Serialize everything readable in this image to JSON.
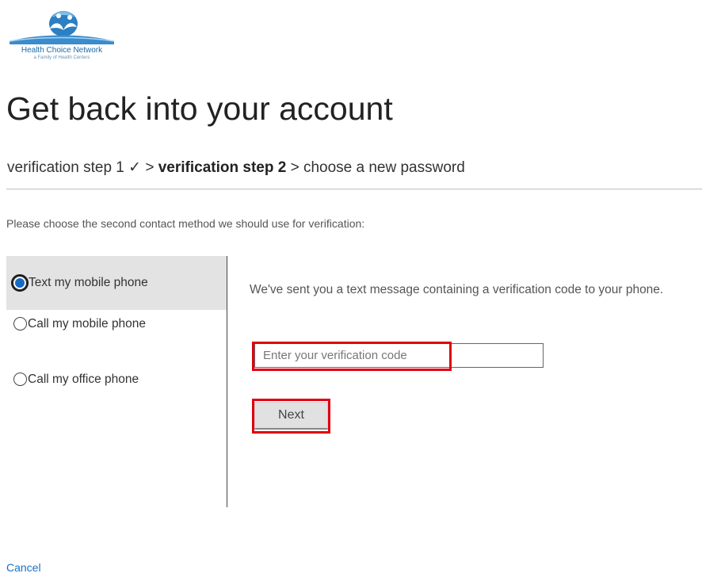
{
  "logo": {
    "name": "Health Choice Network",
    "tagline": "a Family of Health Centers"
  },
  "page": {
    "title": "Get back into your account"
  },
  "steps": {
    "step1": "verification step 1 ✓",
    "separator1": ">",
    "step2": "verification step 2",
    "separator2": ">",
    "step3": "choose a new password"
  },
  "instruction": "Please choose the second contact method we should use for verification:",
  "options": [
    {
      "label": "Text my mobile phone",
      "selected": true
    },
    {
      "label": "Call my mobile phone",
      "selected": false
    },
    {
      "label": "Call my office phone",
      "selected": false
    }
  ],
  "panel": {
    "message": "We've sent you a text message containing a verification code to your phone.",
    "code_input": {
      "value": "",
      "placeholder": "Enter your verification code"
    },
    "next_label": "Next"
  },
  "footer": {
    "cancel_label": "Cancel"
  },
  "colors": {
    "link": "#1a6fc5",
    "radio_selected": "#1769c4",
    "highlight": "#e0000f",
    "selected_bg": "#e3e3e3"
  }
}
